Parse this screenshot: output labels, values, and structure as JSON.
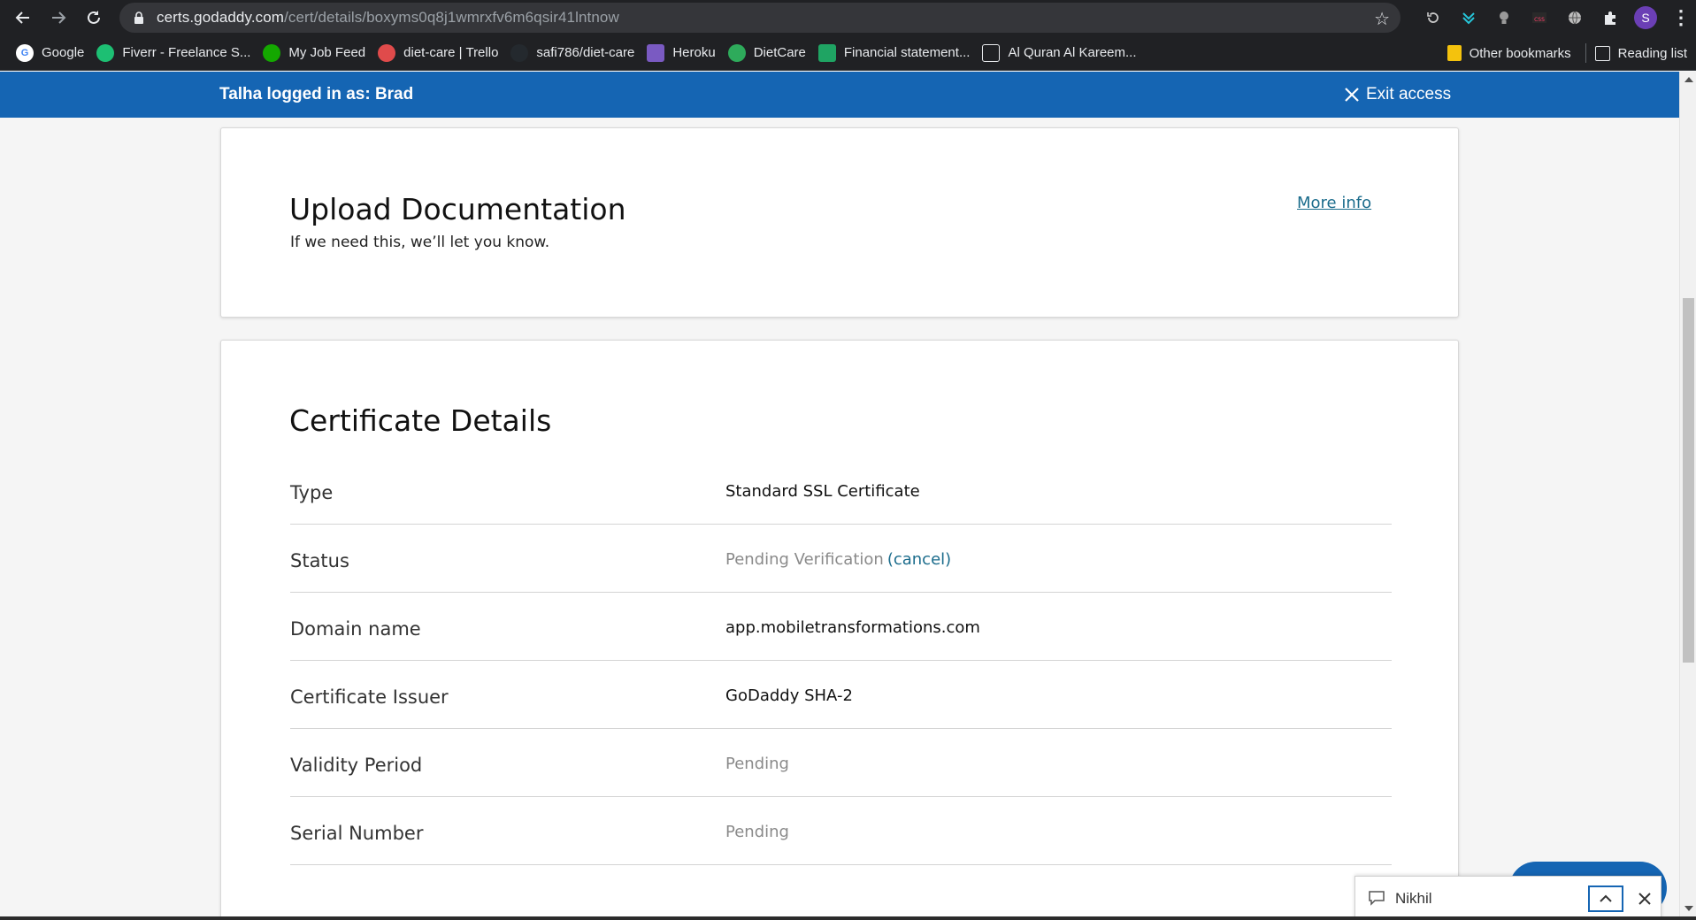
{
  "browser": {
    "url_host": "certs.godaddy.com",
    "url_path": "/cert/details/boxyms0q8j1wmrxfv6m6qsir41lntnow",
    "profile_initial": "S"
  },
  "bookmarks": {
    "items": [
      {
        "label": "Google",
        "icon": "google-icon",
        "color": "#ffffff"
      },
      {
        "label": "Fiverr - Freelance S...",
        "icon": "fiverr-icon",
        "color": "#1dbf73"
      },
      {
        "label": "My Job Feed",
        "icon": "upwork-icon",
        "color": "#14a800"
      },
      {
        "label": "diet-care | Trello",
        "icon": "trello-icon",
        "color": "#e04b4b"
      },
      {
        "label": "safi786/diet-care",
        "icon": "github-icon",
        "color": "#24292e"
      },
      {
        "label": "Heroku",
        "icon": "heroku-icon",
        "color": "#7a5ac2"
      },
      {
        "label": "DietCare",
        "icon": "dietcare-icon",
        "color": "#2eab5b"
      },
      {
        "label": "Financial statement...",
        "icon": "sheets-icon",
        "color": "#1fa463"
      },
      {
        "label": "Al Quran Al Kareem...",
        "icon": "building-icon",
        "color": "#ffffff"
      }
    ],
    "other_bookmarks": "Other bookmarks",
    "reading_list": "Reading list"
  },
  "impersonation": {
    "text": "Talha logged in as: Brad",
    "exit_label": "Exit access",
    "bar_color": "#1565b3"
  },
  "upload_card": {
    "title": "Upload Documentation",
    "subtitle": "If we need this, we’ll let you know.",
    "more_info": "More info"
  },
  "details_card": {
    "title": "Certificate Details",
    "rows": [
      {
        "label": "Type",
        "value": "Standard SSL Certificate",
        "muted": false
      },
      {
        "label": "Status",
        "value": "Pending Verification",
        "muted": true,
        "link": "(cancel)"
      },
      {
        "label": "Domain name",
        "value": "app.mobiletransformations.com",
        "muted": false
      },
      {
        "label": "Certificate Issuer",
        "value": "GoDaddy SHA-2",
        "muted": false
      },
      {
        "label": "Validity Period",
        "value": "Pending",
        "muted": true
      },
      {
        "label": "Serial Number",
        "value": "Pending",
        "muted": true
      }
    ]
  },
  "chat": {
    "agent_name": "Nikhil"
  }
}
